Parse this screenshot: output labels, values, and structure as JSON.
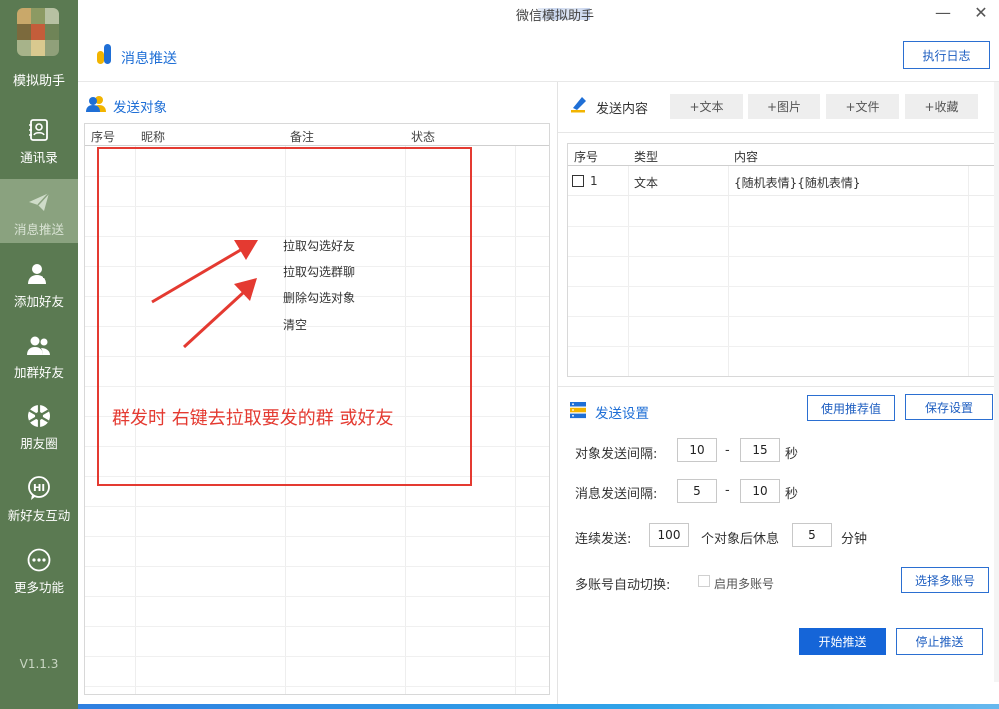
{
  "app": {
    "name": "模拟助手",
    "window_title": "微信模拟助手",
    "window_title_visible": "微信模拟助手",
    "version": "V1.1.3"
  },
  "sidebar": {
    "items": [
      {
        "label": "通讯录",
        "icon": "contacts-icon",
        "active": false
      },
      {
        "label": "消息推送",
        "icon": "send-icon",
        "active": true
      },
      {
        "label": "添加好友",
        "icon": "add-friend-icon",
        "active": false
      },
      {
        "label": "加群好友",
        "icon": "group-icon",
        "active": false
      },
      {
        "label": "朋友圈",
        "icon": "moments-icon",
        "active": false
      },
      {
        "label": "新好友互动",
        "icon": "hi-icon",
        "active": false
      },
      {
        "label": "更多功能",
        "icon": "more-icon",
        "active": false
      }
    ]
  },
  "header": {
    "title": "消息推送",
    "log_button": "执行日志"
  },
  "targets": {
    "title": "发送对象",
    "columns": [
      "序号",
      "昵称",
      "备注",
      "状态"
    ],
    "context_menu": [
      "拉取勾选好友",
      "拉取勾选群聊",
      "删除勾选对象",
      "清空"
    ],
    "annotation": "群发时 右键去拉取要发的群 或好友"
  },
  "content": {
    "title": "发送内容",
    "add_buttons": [
      "+文本",
      "+图片",
      "+文件",
      "+收藏"
    ],
    "columns": [
      "序号",
      "类型",
      "内容"
    ],
    "rows": [
      {
        "index": "1",
        "type": "文本",
        "content": "{随机表情}{随机表情}"
      }
    ]
  },
  "settings": {
    "title": "发送设置",
    "recommend_button": "使用推荐值",
    "save_button": "保存设置",
    "target_interval_label": "对象发送间隔:",
    "target_interval_min": "10",
    "target_interval_max": "15",
    "message_interval_label": "消息发送间隔:",
    "message_interval_min": "5",
    "message_interval_max": "10",
    "dash": "-",
    "seconds_unit": "秒",
    "continuous_label": "连续发送:",
    "continuous_count": "100",
    "continuous_mid": "个对象后休息",
    "rest_minutes": "5",
    "minutes_unit": "分钟",
    "multi_account_label": "多账号自动切换:",
    "multi_account_checkbox": "启用多账号",
    "choose_accounts_button": "选择多账号",
    "start_button": "开始推送",
    "stop_button": "停止推送"
  },
  "colors": {
    "sidebar_bg": "#5b7a52",
    "sidebar_active": "#8aa27f",
    "accent_blue": "#1565d8",
    "annotation_red": "#e43a31"
  }
}
